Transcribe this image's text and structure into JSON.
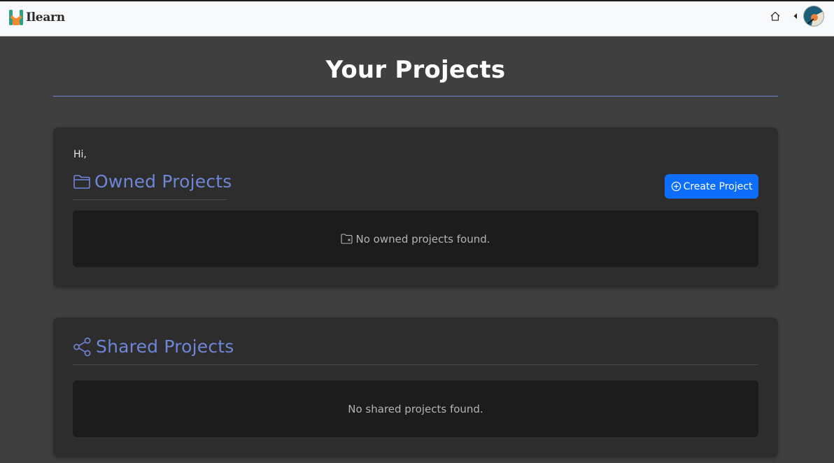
{
  "navbar": {
    "brand_name": "Ilearn",
    "icons": {
      "home": "house-icon",
      "caret": "caret-left-icon",
      "avatar": "user-avatar"
    }
  },
  "page": {
    "title": "Your Projects"
  },
  "owned": {
    "greeting": "Hi,",
    "heading": "Owned Projects",
    "heading_icon": "folder-icon",
    "create_button_label": "Create Project",
    "create_button_icon": "plus-circle-icon",
    "empty_message": "No owned projects found.",
    "empty_icon": "folder-x-icon"
  },
  "shared": {
    "heading": "Shared Projects",
    "heading_icon": "share-icon",
    "empty_message": "No shared projects found."
  },
  "colors": {
    "background": "#3f3f3f",
    "card": "#2d2d2d",
    "empty_box": "#1c1c1c",
    "accent": "#6f86d6",
    "primary_button": "#0d6efd",
    "navbar": "#f8f9fa"
  }
}
